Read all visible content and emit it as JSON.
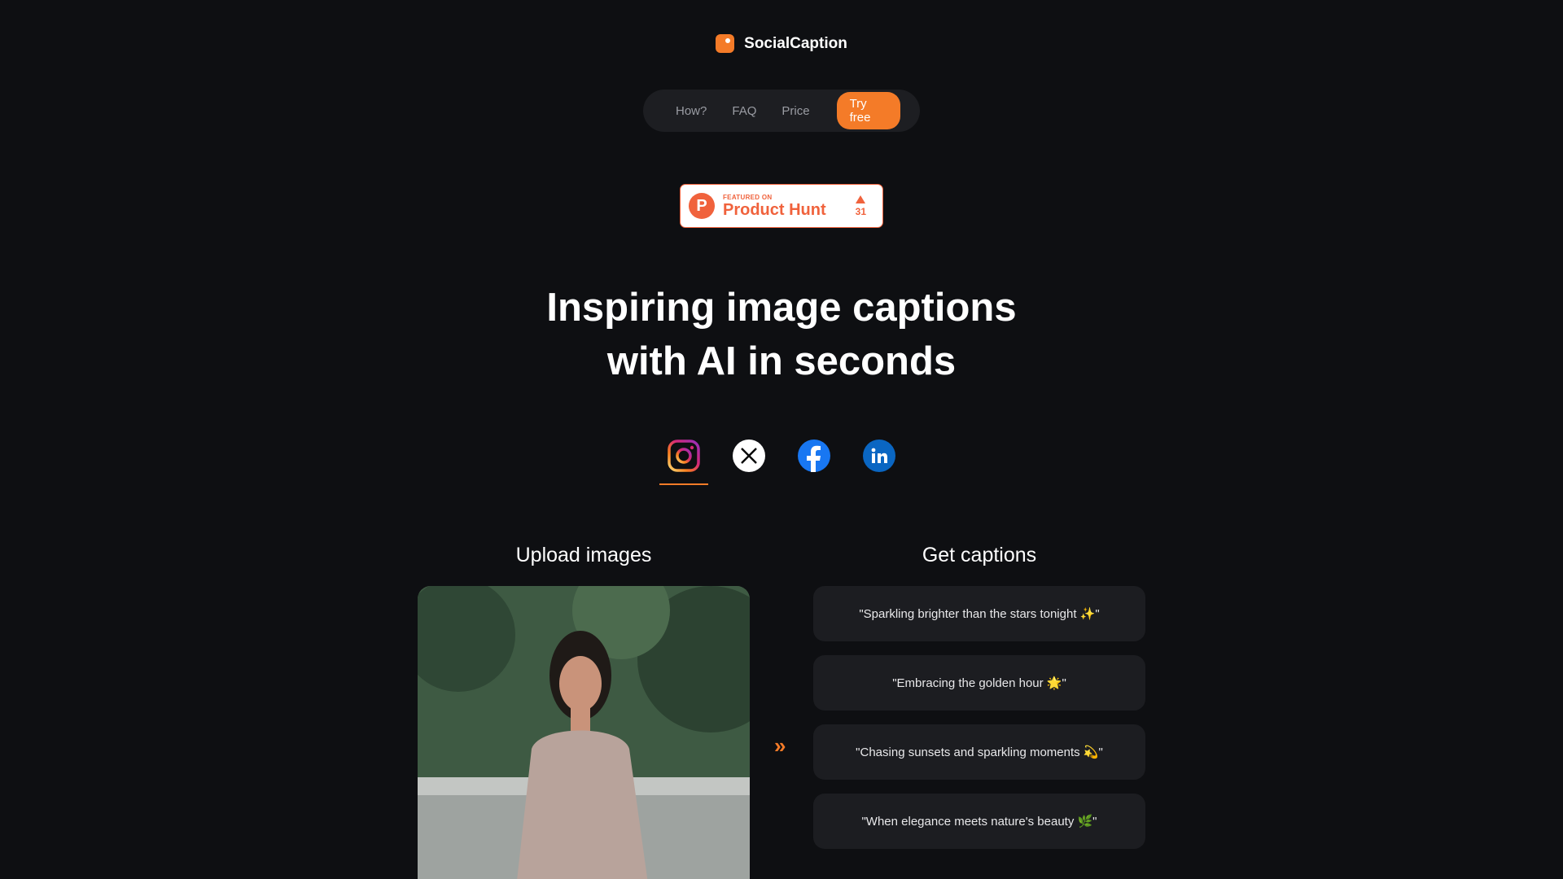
{
  "brand": {
    "name": "SocialCaption",
    "accent": "#f47b28"
  },
  "nav": {
    "items": [
      "How?",
      "FAQ",
      "Price"
    ],
    "cta": "Try free"
  },
  "product_hunt": {
    "featured_on": "FEATURED ON",
    "name": "Product Hunt",
    "votes": "31"
  },
  "headline": {
    "line1": "Inspiring image captions",
    "line2": "with AI in seconds"
  },
  "platforms": [
    {
      "name": "instagram-icon",
      "selected": true
    },
    {
      "name": "x-icon",
      "selected": false
    },
    {
      "name": "facebook-icon",
      "selected": false
    },
    {
      "name": "linkedin-icon",
      "selected": false
    }
  ],
  "upload": {
    "title": "Upload images"
  },
  "captions": {
    "title": "Get captions",
    "items": [
      "\"Sparkling brighter than the stars tonight ✨\"",
      "\"Embracing the golden hour 🌟\"",
      "\"Chasing sunsets and sparkling moments 💫\"",
      "\"When elegance meets nature's beauty 🌿\""
    ]
  },
  "arrow_glyph": "»"
}
